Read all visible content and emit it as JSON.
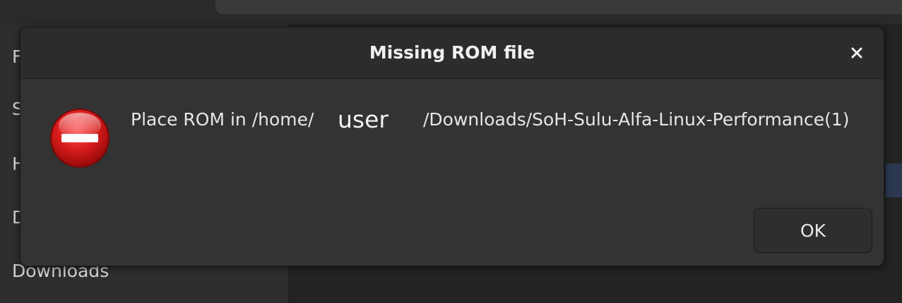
{
  "background": {
    "sidebar_items": [
      {
        "label": "F"
      },
      {
        "label": "S"
      },
      {
        "label": "H"
      },
      {
        "label": "D"
      },
      {
        "label": "Downloads"
      }
    ]
  },
  "dialog": {
    "title": "Missing ROM file",
    "message_prefix": "Place ROM in /home/",
    "message_user": "user",
    "message_suffix": "/Downloads/SoH-Sulu-Alfa-Linux-Performance(1)",
    "ok_label": "OK",
    "icon": "dialog-error-icon",
    "close_icon": "close-icon"
  },
  "colors": {
    "error_red": "#d42020",
    "dialog_bg": "#333333",
    "header_bg": "#2c2c2c"
  }
}
